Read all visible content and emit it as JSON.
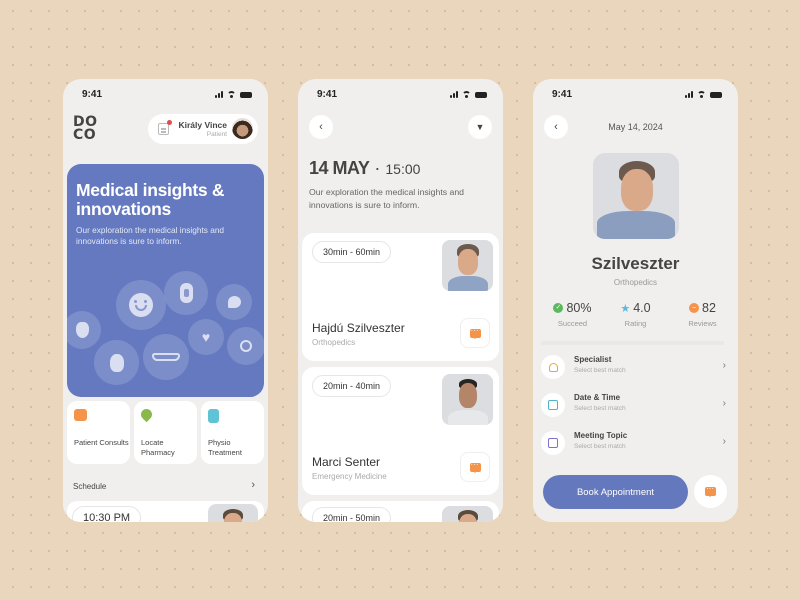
{
  "status_bar": {
    "time": "9:41"
  },
  "home": {
    "logo_line1": "DO",
    "logo_line2": "CO",
    "user": {
      "name": "Király Vince",
      "role": "Patient"
    },
    "hero": {
      "title": "Medical insights & innovations",
      "subtitle": "Our exploration the medical insights and innovations is sure to inform.",
      "icons": [
        "mask-icon",
        "smile-icon",
        "bandage-icon",
        "chat-bubble-icon",
        "heart-icon",
        "lollipop-icon",
        "nose-icon",
        "glasses-icon"
      ]
    },
    "tiles": [
      {
        "label": "Patient Consults",
        "icon": "chat-icon",
        "color": "#f4944a"
      },
      {
        "label": "Locate Pharmacy",
        "icon": "location-plus-icon",
        "color": "#8ab94a"
      },
      {
        "label": "Physio Treatment",
        "icon": "clipboard-icon",
        "color": "#5fc3d6"
      }
    ],
    "schedule_label": "Schedule",
    "schedule_time": "10:30 PM"
  },
  "appointments": {
    "date": "14 MAY",
    "time": "15:00",
    "description": "Our exploration the medical insights and innovations is sure to inform.",
    "doctors": [
      {
        "duration": "30min - 60min",
        "name": "Hajdú Szilveszter",
        "specialty": "Orthopedics"
      },
      {
        "duration": "20min - 40min",
        "name": "Marci Senter",
        "specialty": "Emergency Medicine"
      },
      {
        "duration": "20min - 50min",
        "name": "",
        "specialty": ""
      }
    ]
  },
  "profile": {
    "date": "May 14, 2024",
    "name": "Szilveszter",
    "specialty": "Orthopedics",
    "stats": [
      {
        "value": "80%",
        "label": "Succeed",
        "color": "#5cb85c"
      },
      {
        "value": "4.0",
        "label": "Rating",
        "color": "#5bb7e0"
      },
      {
        "value": "82",
        "label": "Reviews",
        "color": "#f4944a"
      }
    ],
    "options": [
      {
        "title": "Specialist",
        "subtitle": "Select best match"
      },
      {
        "title": "Date & Time",
        "subtitle": "Select best match"
      },
      {
        "title": "Meeting Topic",
        "subtitle": "Select best match"
      }
    ],
    "book_label": "Book Appointment"
  },
  "colors": {
    "accent": "#6479bf",
    "orange": "#f4944a",
    "background": "#ead6bd"
  }
}
